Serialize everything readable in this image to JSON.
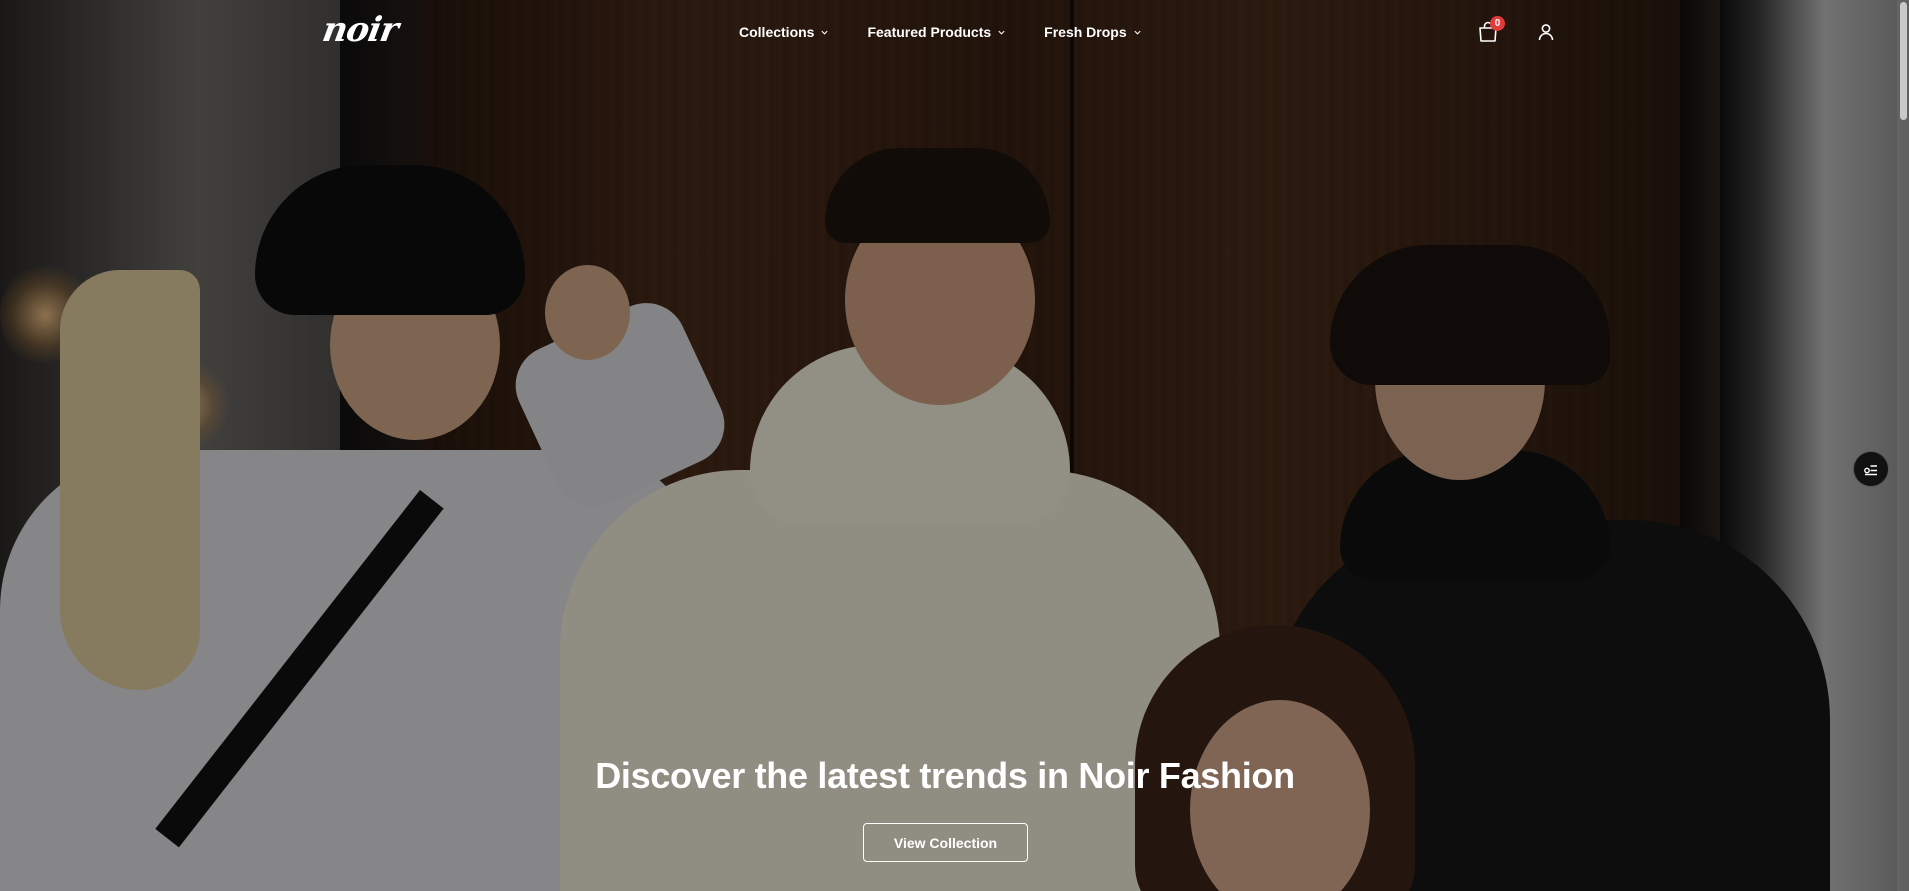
{
  "brand": {
    "logo_text": "noir"
  },
  "nav": {
    "items": [
      {
        "label": "Collections",
        "icon": "chevron-down-icon"
      },
      {
        "label": "Featured Products",
        "icon": "chevron-down-icon"
      },
      {
        "label": "Fresh Drops",
        "icon": "chevron-down-icon"
      }
    ],
    "cart": {
      "icon": "shopping-bag-icon",
      "count": "0"
    },
    "account": {
      "icon": "user-icon"
    }
  },
  "hero": {
    "headline": "Discover the latest trends in Noir Fashion",
    "cta_label": "View Collection"
  },
  "floating": {
    "icon": "filter-toggle-icon"
  },
  "colors": {
    "badge": "#e23b3b",
    "overlay": "rgba(0,0,0,0.38)",
    "text": "#ffffff"
  }
}
